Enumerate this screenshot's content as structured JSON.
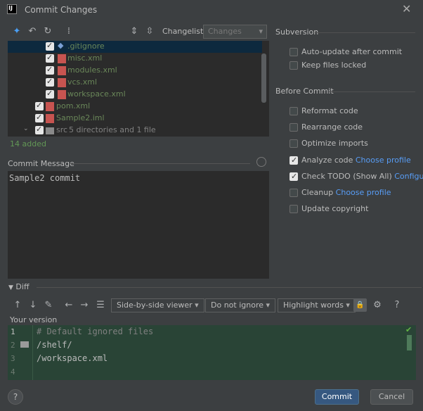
{
  "window": {
    "title": "Commit Changes"
  },
  "toolbar": {
    "changelist_label": "Changelist:",
    "changelist_value": "Changes",
    "icons": [
      "show-diff-icon",
      "rollback-icon",
      "refresh-icon",
      "group-by-icon",
      "expand-all-icon",
      "collapse-all-icon"
    ]
  },
  "tree": {
    "items": [
      {
        "name": ".gitignore",
        "checked": true
      },
      {
        "name": "misc.xml",
        "checked": true
      },
      {
        "name": "modules.xml",
        "checked": true
      },
      {
        "name": "vcs.xml",
        "checked": true
      },
      {
        "name": "workspace.xml",
        "checked": true
      },
      {
        "name": "pom.xml",
        "checked": true
      },
      {
        "name": "Sample2.iml",
        "checked": true
      },
      {
        "name": "src",
        "detail": "5 directories and 1 file",
        "checked": true
      }
    ],
    "status": "14 added"
  },
  "commit_message": {
    "label": "Commit Message",
    "value": "Sample2 commit"
  },
  "subversion": {
    "heading": "Subversion",
    "options": [
      {
        "label": "Auto-update after commit",
        "checked": false
      },
      {
        "label": "Keep files locked",
        "checked": false
      }
    ]
  },
  "before_commit": {
    "heading": "Before Commit",
    "options": [
      {
        "label": "Reformat code",
        "checked": false,
        "link": ""
      },
      {
        "label": "Rearrange code",
        "checked": false,
        "link": ""
      },
      {
        "label": "Optimize imports",
        "checked": false,
        "link": ""
      },
      {
        "label": "Analyze code",
        "checked": true,
        "link": "Choose profile"
      },
      {
        "label": "Check TODO (Show All)",
        "checked": true,
        "link": "Configure"
      },
      {
        "label": "Cleanup",
        "checked": false,
        "link": "Choose profile"
      },
      {
        "label": "Update copyright",
        "checked": false,
        "link": ""
      }
    ]
  },
  "diff": {
    "heading": "Diff",
    "viewer": "Side-by-side viewer",
    "ignore": "Do not ignore",
    "highlight": "Highlight words",
    "help_glyph": "?",
    "version_label": "Your version",
    "lines": [
      {
        "num": "1",
        "text": "# Default ignored files"
      },
      {
        "num": "2",
        "text": "/shelf/"
      },
      {
        "num": "3",
        "text": "/workspace.xml"
      },
      {
        "num": "4",
        "text": ""
      }
    ]
  },
  "footer": {
    "help": "?",
    "commit": "Commit",
    "cancel": "Cancel"
  },
  "colors": {
    "background": "#3c3f41",
    "panel": "#2b2b2b",
    "added_file": "#6a8759",
    "link": "#589df6",
    "primary_button": "#365880",
    "diff_bg": "#294436"
  }
}
